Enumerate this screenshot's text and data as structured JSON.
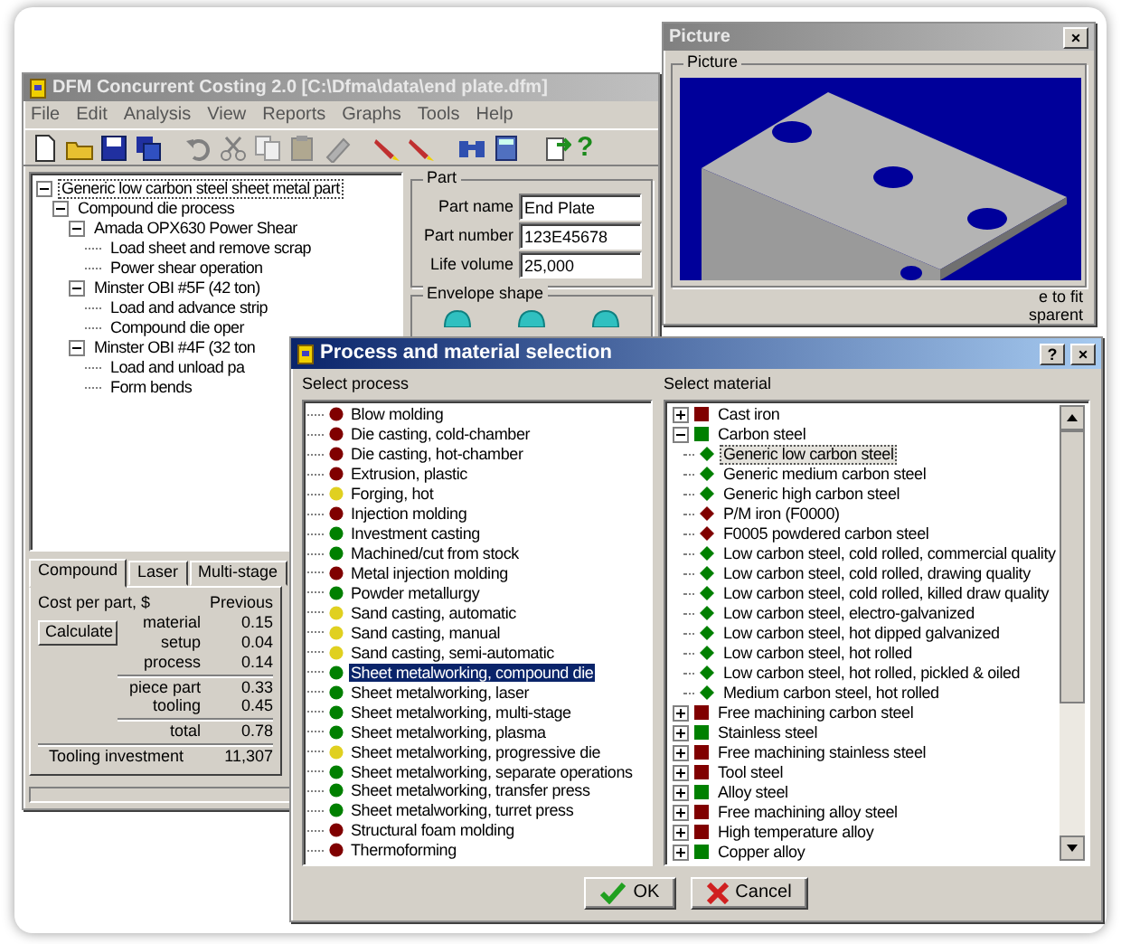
{
  "main_window": {
    "title": "DFM Concurrent Costing 2.0 [C:\\Dfma\\data\\end plate.dfm]",
    "menu": [
      "File",
      "Edit",
      "Analysis",
      "View",
      "Reports",
      "Graphs",
      "Tools",
      "Help"
    ],
    "toolbar": {
      "help_glyph": "?"
    },
    "tree": [
      {
        "label": "Generic low carbon steel sheet metal part",
        "selected": true,
        "expanded": true,
        "children": [
          {
            "label": "Compound die process",
            "selected": false,
            "expanded": true,
            "children": [
              {
                "label": "Amada OPX630 Power Shear",
                "selected": false,
                "expanded": true,
                "children": [
                  {
                    "label": "Load sheet and remove scrap",
                    "selected": false
                  },
                  {
                    "label": "Power shear operation",
                    "selected": false
                  }
                ]
              },
              {
                "label": "Minster OBI #5F (42 ton)",
                "selected": false,
                "expanded": true,
                "children": [
                  {
                    "label": "Load and advance strip",
                    "selected": false
                  },
                  {
                    "label": "Compound die oper",
                    "selected": false
                  }
                ]
              },
              {
                "label": "Minster OBI #4F (32 ton",
                "selected": false,
                "expanded": true,
                "children": [
                  {
                    "label": "Load and unload pa",
                    "selected": false
                  },
                  {
                    "label": "Form bends",
                    "selected": false
                  }
                ]
              }
            ]
          }
        ]
      }
    ],
    "part": {
      "title": "Part",
      "fields": [
        {
          "label": "Part name",
          "value": "End Plate"
        },
        {
          "label": "Part number",
          "value": "123E45678"
        },
        {
          "label": "Life volume",
          "value": "25,000"
        }
      ]
    },
    "envelope_shape": {
      "title": "Envelope shape"
    },
    "tabs": [
      {
        "label": "Compound",
        "selected": true
      },
      {
        "label": "Laser",
        "selected": false
      },
      {
        "label": "Multi-stage",
        "selected": false
      }
    ],
    "cost": {
      "heading": "Cost per part, $",
      "column": "Previous",
      "calculate_button": "Calculate",
      "groups": [
        [
          {
            "label": "material",
            "value": "0.15"
          },
          {
            "label": "setup",
            "value": "0.04"
          },
          {
            "label": "process",
            "value": "0.14"
          }
        ],
        [
          {
            "label": "piece part",
            "value": "0.33"
          },
          {
            "label": "tooling",
            "value": "0.45"
          }
        ],
        [
          {
            "label": "total",
            "value": "0.78"
          }
        ]
      ],
      "investment": {
        "label": "Tooling investment",
        "value": "11,307"
      }
    }
  },
  "picture_window": {
    "title": "Picture",
    "close_button": "×",
    "group": "Picture",
    "options": [
      "e to fit",
      "sparent"
    ]
  },
  "dialog": {
    "title": "Process and material selection",
    "help_button": "?",
    "close_button": "×",
    "process_label": "Select process",
    "material_label": "Select material",
    "processes": [
      {
        "label": "Blow molding",
        "color": "#800000",
        "selected": false
      },
      {
        "label": "Die casting, cold-chamber",
        "color": "#800000",
        "selected": false
      },
      {
        "label": "Die casting, hot-chamber",
        "color": "#800000",
        "selected": false
      },
      {
        "label": "Extrusion, plastic",
        "color": "#800000",
        "selected": false
      },
      {
        "label": "Forging, hot",
        "color": "#e0d020",
        "selected": false
      },
      {
        "label": "Injection molding",
        "color": "#800000",
        "selected": false
      },
      {
        "label": "Investment casting",
        "color": "#008000",
        "selected": false
      },
      {
        "label": "Machined/cut from stock",
        "color": "#008000",
        "selected": false
      },
      {
        "label": "Metal injection molding",
        "color": "#800000",
        "selected": false
      },
      {
        "label": "Powder metallurgy",
        "color": "#008000",
        "selected": false
      },
      {
        "label": "Sand casting, automatic",
        "color": "#e0d020",
        "selected": false
      },
      {
        "label": "Sand casting, manual",
        "color": "#e0d020",
        "selected": false
      },
      {
        "label": "Sand casting, semi-automatic",
        "color": "#e0d020",
        "selected": false
      },
      {
        "label": "Sheet metalworking, compound die",
        "color": "#008000",
        "selected": true
      },
      {
        "label": "Sheet metalworking, laser",
        "color": "#008000",
        "selected": false
      },
      {
        "label": "Sheet metalworking, multi-stage",
        "color": "#008000",
        "selected": false
      },
      {
        "label": "Sheet metalworking, plasma",
        "color": "#008000",
        "selected": false
      },
      {
        "label": "Sheet metalworking, progressive die",
        "color": "#e0d020",
        "selected": false
      },
      {
        "label": "Sheet metalworking, separate operations",
        "color": "#008000",
        "selected": false
      },
      {
        "label": "Sheet metalworking, transfer press",
        "color": "#008000",
        "selected": false
      },
      {
        "label": "Sheet metalworking, turret press",
        "color": "#008000",
        "selected": false
      },
      {
        "label": "Structural foam molding",
        "color": "#800000",
        "selected": false
      },
      {
        "label": "Thermoforming",
        "color": "#800000",
        "selected": false
      }
    ],
    "materials": [
      {
        "label": "Cast iron",
        "color": "#800000",
        "expanded": false
      },
      {
        "label": "Carbon steel",
        "color": "#008000",
        "expanded": true,
        "children": [
          {
            "label": "Generic low carbon steel",
            "color": "#008000",
            "selected": true
          },
          {
            "label": "Generic medium carbon steel",
            "color": "#008000",
            "selected": false
          },
          {
            "label": "Generic high carbon steel",
            "color": "#008000",
            "selected": false
          },
          {
            "label": "P/M iron (F0000)",
            "color": "#800000",
            "selected": false
          },
          {
            "label": "F0005 powdered carbon steel",
            "color": "#800000",
            "selected": false
          },
          {
            "label": "Low carbon steel, cold rolled, commercial quality",
            "color": "#008000",
            "selected": false
          },
          {
            "label": "Low carbon steel, cold rolled, drawing quality",
            "color": "#008000",
            "selected": false
          },
          {
            "label": "Low carbon steel, cold rolled, killed draw quality",
            "color": "#008000",
            "selected": false
          },
          {
            "label": "Low carbon steel, electro-galvanized",
            "color": "#008000",
            "selected": false
          },
          {
            "label": "Low carbon steel, hot dipped galvanized",
            "color": "#008000",
            "selected": false
          },
          {
            "label": "Low carbon steel, hot rolled",
            "color": "#008000",
            "selected": false
          },
          {
            "label": "Low carbon steel, hot rolled, pickled & oiled",
            "color": "#008000",
            "selected": false
          },
          {
            "label": "Medium carbon steel, hot rolled",
            "color": "#008000",
            "selected": false
          }
        ]
      },
      {
        "label": "Free machining carbon steel",
        "color": "#800000",
        "expanded": false
      },
      {
        "label": "Stainless steel",
        "color": "#008000",
        "expanded": false
      },
      {
        "label": "Free machining stainless steel",
        "color": "#800000",
        "expanded": false
      },
      {
        "label": "Tool steel",
        "color": "#800000",
        "expanded": false
      },
      {
        "label": "Alloy steel",
        "color": "#008000",
        "expanded": false
      },
      {
        "label": "Free machining alloy steel",
        "color": "#800000",
        "expanded": false
      },
      {
        "label": "High temperature alloy",
        "color": "#800000",
        "expanded": false
      },
      {
        "label": "Copper alloy",
        "color": "#008000",
        "expanded": false
      }
    ],
    "buttons": [
      {
        "label": "OK",
        "kind": "ok"
      },
      {
        "label": "Cancel",
        "kind": "cancel"
      }
    ]
  }
}
